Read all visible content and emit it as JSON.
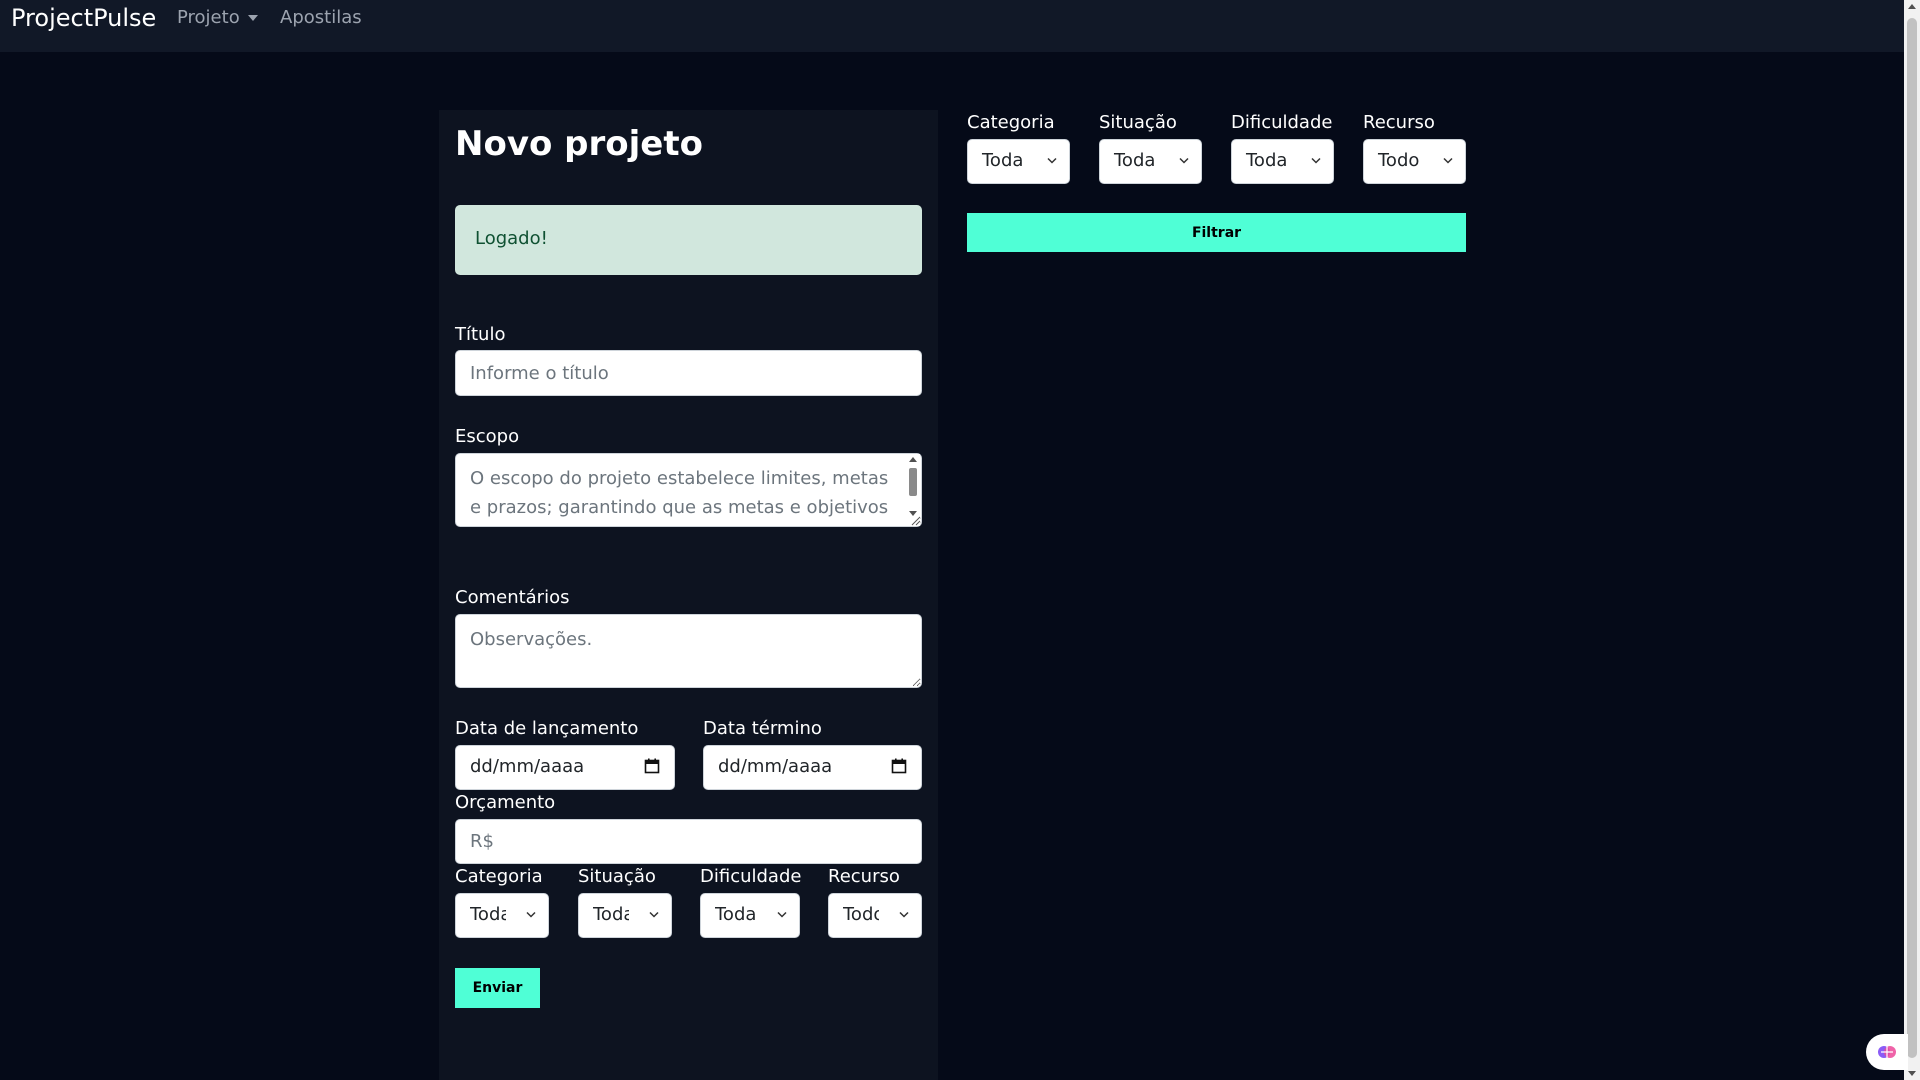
{
  "navbar": {
    "brand": "ProjectPulse",
    "projeto_label": "Projeto",
    "apostilas_label": "Apostilas"
  },
  "form": {
    "title": "Novo projeto",
    "alert_text": "Logado!",
    "titulo": {
      "label": "Título",
      "placeholder": "Informe o título"
    },
    "escopo": {
      "label": "Escopo",
      "value": "O escopo do projeto estabelece limites, metas e prazos; garantindo que as metas e objetivos sejam alcançados."
    },
    "comentarios": {
      "label": "Comentários",
      "placeholder": "Observações."
    },
    "data_lancamento": {
      "label": "Data de lançamento",
      "value": "dd/mm/aaaa"
    },
    "data_termino": {
      "label": "Data término",
      "value": "dd/mm/aaaa"
    },
    "orcamento": {
      "label": "Orçamento",
      "placeholder": "R$"
    },
    "categoria": {
      "label": "Categoria",
      "value": "Toda"
    },
    "situacao": {
      "label": "Situação",
      "value": "Toda"
    },
    "dificuldade": {
      "label": "Dificuldade",
      "value": "Toda"
    },
    "recurso": {
      "label": "Recurso",
      "value": "Todo"
    },
    "submit_label": "Enviar"
  },
  "filters": {
    "categoria": {
      "label": "Categoria",
      "value": "Toda"
    },
    "situacao": {
      "label": "Situação",
      "value": "Toda"
    },
    "dificuldade": {
      "label": "Dificuldade",
      "value": "Toda"
    },
    "recurso": {
      "label": "Recurso",
      "value": "Todo"
    },
    "filter_label": "Filtrar"
  },
  "icons": {
    "calendar": "calendar-icon",
    "chevron": "chevron-down-icon",
    "extension": "brain-icon"
  },
  "colors": {
    "accent": "#4fffd6",
    "background": "#050a18",
    "panel": "#0d1320",
    "navbar": "#111827",
    "alert_bg": "#d1e7dd",
    "alert_text": "#0f5132"
  }
}
